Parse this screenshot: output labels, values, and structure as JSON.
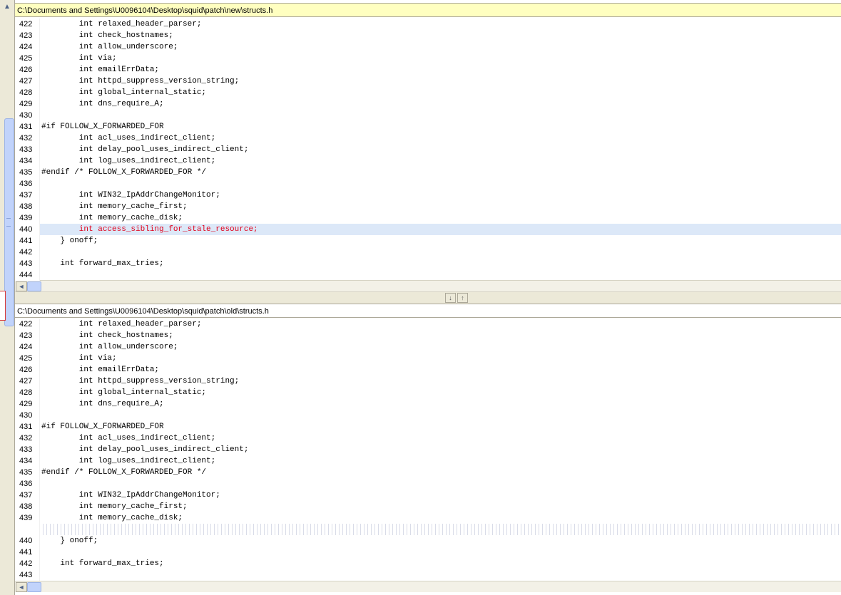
{
  "overview": {
    "up_arrow": "▲"
  },
  "top_pane": {
    "path": "C:\\Documents and Settings\\U0096104\\Desktop\\squid\\patch\\new\\structs.h",
    "lines": [
      {
        "n": "422",
        "t": "        int relaxed_header_parser;"
      },
      {
        "n": "423",
        "t": "        int check_hostnames;"
      },
      {
        "n": "424",
        "t": "        int allow_underscore;"
      },
      {
        "n": "425",
        "t": "        int via;"
      },
      {
        "n": "426",
        "t": "        int emailErrData;"
      },
      {
        "n": "427",
        "t": "        int httpd_suppress_version_string;"
      },
      {
        "n": "428",
        "t": "        int global_internal_static;"
      },
      {
        "n": "429",
        "t": "        int dns_require_A;"
      },
      {
        "n": "430",
        "t": ""
      },
      {
        "n": "431",
        "t": "#if FOLLOW_X_FORWARDED_FOR"
      },
      {
        "n": "432",
        "t": "        int acl_uses_indirect_client;"
      },
      {
        "n": "433",
        "t": "        int delay_pool_uses_indirect_client;"
      },
      {
        "n": "434",
        "t": "        int log_uses_indirect_client;"
      },
      {
        "n": "435",
        "t": "#endif /* FOLLOW_X_FORWARDED_FOR */"
      },
      {
        "n": "436",
        "t": ""
      },
      {
        "n": "437",
        "t": "        int WIN32_IpAddrChangeMonitor;"
      },
      {
        "n": "438",
        "t": "        int memory_cache_first;"
      },
      {
        "n": "439",
        "t": "        int memory_cache_disk;"
      },
      {
        "n": "440",
        "t": "        int access_sibling_for_stale_resource;",
        "state": "changed"
      },
      {
        "n": "441",
        "t": "    } onoff;"
      },
      {
        "n": "442",
        "t": ""
      },
      {
        "n": "443",
        "t": "    int forward_max_tries;"
      },
      {
        "n": "444",
        "t": ""
      }
    ]
  },
  "bottom_pane": {
    "path": "C:\\Documents and Settings\\U0096104\\Desktop\\squid\\patch\\old\\structs.h",
    "lines": [
      {
        "n": "422",
        "t": "        int relaxed_header_parser;"
      },
      {
        "n": "423",
        "t": "        int check_hostnames;"
      },
      {
        "n": "424",
        "t": "        int allow_underscore;"
      },
      {
        "n": "425",
        "t": "        int via;"
      },
      {
        "n": "426",
        "t": "        int emailErrData;"
      },
      {
        "n": "427",
        "t": "        int httpd_suppress_version_string;"
      },
      {
        "n": "428",
        "t": "        int global_internal_static;"
      },
      {
        "n": "429",
        "t": "        int dns_require_A;"
      },
      {
        "n": "430",
        "t": ""
      },
      {
        "n": "431",
        "t": "#if FOLLOW_X_FORWARDED_FOR"
      },
      {
        "n": "432",
        "t": "        int acl_uses_indirect_client;"
      },
      {
        "n": "433",
        "t": "        int delay_pool_uses_indirect_client;"
      },
      {
        "n": "434",
        "t": "        int log_uses_indirect_client;"
      },
      {
        "n": "435",
        "t": "#endif /* FOLLOW_X_FORWARDED_FOR */"
      },
      {
        "n": "436",
        "t": ""
      },
      {
        "n": "437",
        "t": "        int WIN32_IpAddrChangeMonitor;"
      },
      {
        "n": "438",
        "t": "        int memory_cache_first;"
      },
      {
        "n": "439",
        "t": "        int memory_cache_disk;"
      },
      {
        "n": "",
        "t": "",
        "state": "missing"
      },
      {
        "n": "440",
        "t": "    } onoff;"
      },
      {
        "n": "441",
        "t": ""
      },
      {
        "n": "442",
        "t": "    int forward_max_tries;"
      },
      {
        "n": "443",
        "t": ""
      }
    ]
  },
  "splitter": {
    "down_glyph": "↓",
    "up_glyph": "↑"
  },
  "scroll": {
    "left_glyph": "◄"
  },
  "colors": {
    "changed_text": "#e0001b",
    "changed_bg": "#dce8f8",
    "header_active": "#ffffc0"
  }
}
